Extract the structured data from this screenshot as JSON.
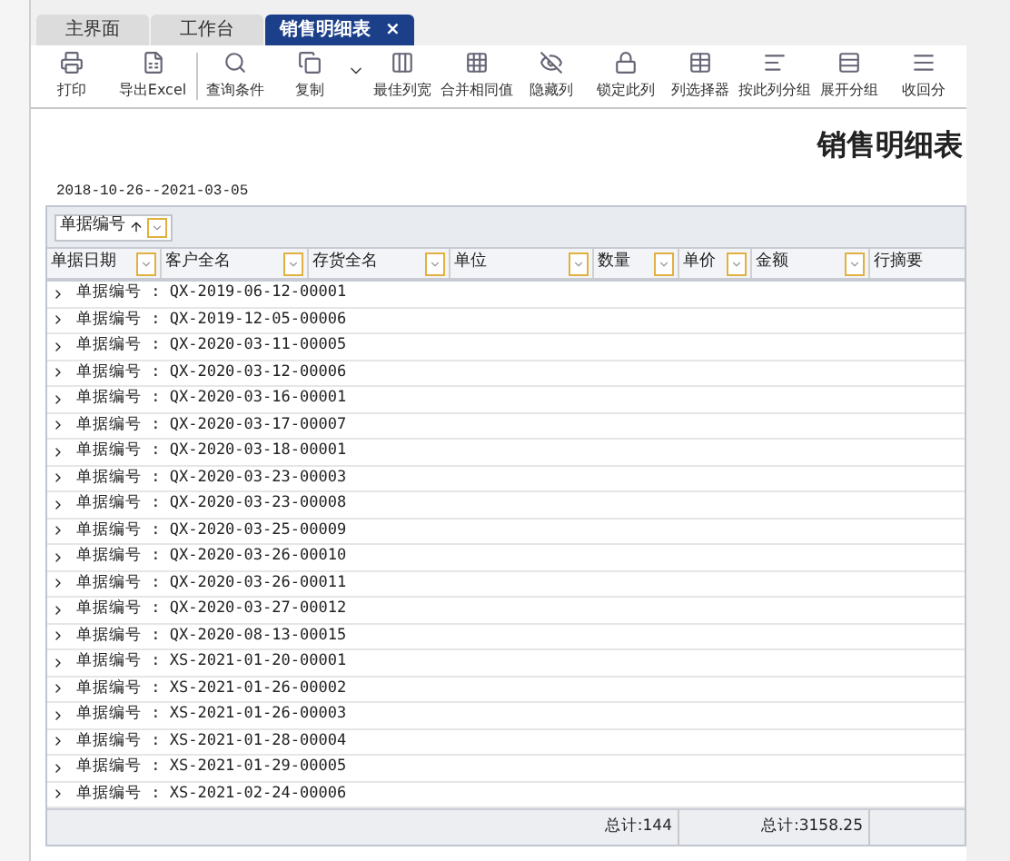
{
  "tabs": [
    {
      "label": "主界面",
      "selected": false,
      "closable": false
    },
    {
      "label": "工作台",
      "selected": false,
      "closable": false
    },
    {
      "label": "销售明细表",
      "selected": true,
      "closable": true
    }
  ],
  "tab_close": "×",
  "toolbar": [
    {
      "label": "打印",
      "kind": "print"
    },
    {
      "label": "导出Excel",
      "kind": "export"
    },
    {
      "label": "查询条件",
      "kind": "query"
    },
    {
      "label": "复制",
      "kind": "copy"
    },
    {
      "label": "最佳列宽",
      "kind": "fit"
    },
    {
      "label": "合并相同值",
      "kind": "merge"
    },
    {
      "label": "隐藏列",
      "kind": "hide"
    },
    {
      "label": "锁定此列",
      "kind": "lock"
    },
    {
      "label": "列选择器",
      "kind": "chooser"
    },
    {
      "label": "按此列分组",
      "kind": "group"
    },
    {
      "label": "展开分组",
      "kind": "expand"
    },
    {
      "label": "收回分",
      "kind": "collapse"
    }
  ],
  "report_title": "销售明细表",
  "date_range": "2018-10-26--2021-03-05",
  "group_panel": {
    "label": "单据编号"
  },
  "columns": [
    "单据日期",
    "客户全名",
    "存货全名",
    "单位",
    "数量",
    "单价",
    "金额",
    "行摘要"
  ],
  "rows": [
    "单据编号 : QX-2019-06-12-00001",
    "单据编号 : QX-2019-12-05-00006",
    "单据编号 : QX-2020-03-11-00005",
    "单据编号 : QX-2020-03-12-00006",
    "单据编号 : QX-2020-03-16-00001",
    "单据编号 : QX-2020-03-17-00007",
    "单据编号 : QX-2020-03-18-00001",
    "单据编号 : QX-2020-03-23-00003",
    "单据编号 : QX-2020-03-23-00008",
    "单据编号 : QX-2020-03-25-00009",
    "单据编号 : QX-2020-03-26-00010",
    "单据编号 : QX-2020-03-26-00011",
    "单据编号 : QX-2020-03-27-00012",
    "单据编号 : QX-2020-08-13-00015",
    "单据编号 : XS-2021-01-20-00001",
    "单据编号 : XS-2021-01-26-00002",
    "单据编号 : XS-2021-01-26-00003",
    "单据编号 : XS-2021-01-28-00004",
    "单据编号 : XS-2021-01-29-00005",
    "单据编号 : XS-2021-02-24-00006"
  ],
  "footer": {
    "quantity_total": "总计:144",
    "amount_total": "总计:3158.25"
  }
}
